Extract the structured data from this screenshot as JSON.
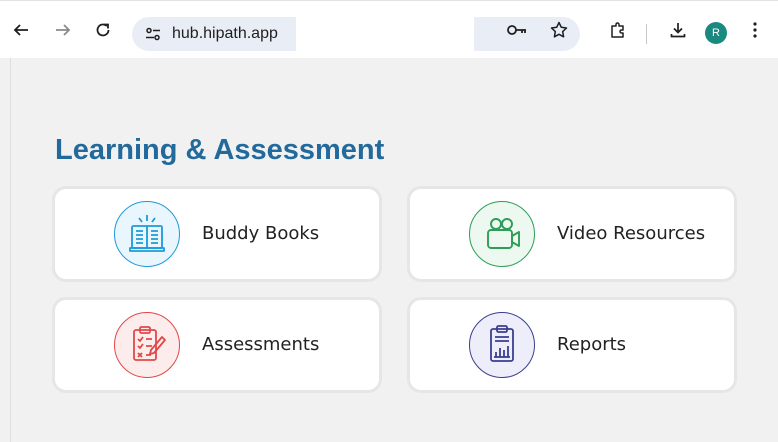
{
  "browser": {
    "url": "hub.hipath.app",
    "profile_initial": "R",
    "icons": [
      "back-arrow-icon",
      "forward-arrow-icon",
      "reload-icon",
      "site-info-icon",
      "password-key-icon",
      "bookmark-star-icon",
      "extensions-puzzle-icon",
      "download-icon",
      "menu-dots-icon"
    ]
  },
  "page": {
    "heading": "Learning & Assessment",
    "cards": [
      {
        "label": "Buddy Books",
        "icon": "book-icon",
        "color": "#1e9ad6"
      },
      {
        "label": "Video Resources",
        "icon": "video-camera-icon",
        "color": "#2e9e57"
      },
      {
        "label": "Assessments",
        "icon": "clipboard-pencil-icon",
        "color": "#e04848"
      },
      {
        "label": "Reports",
        "icon": "report-chart-icon",
        "color": "#3b3e8f"
      }
    ]
  },
  "colors": {
    "heading": "#236a9c",
    "page_background": "#f1f1f1",
    "avatar": "#1a8a80"
  }
}
